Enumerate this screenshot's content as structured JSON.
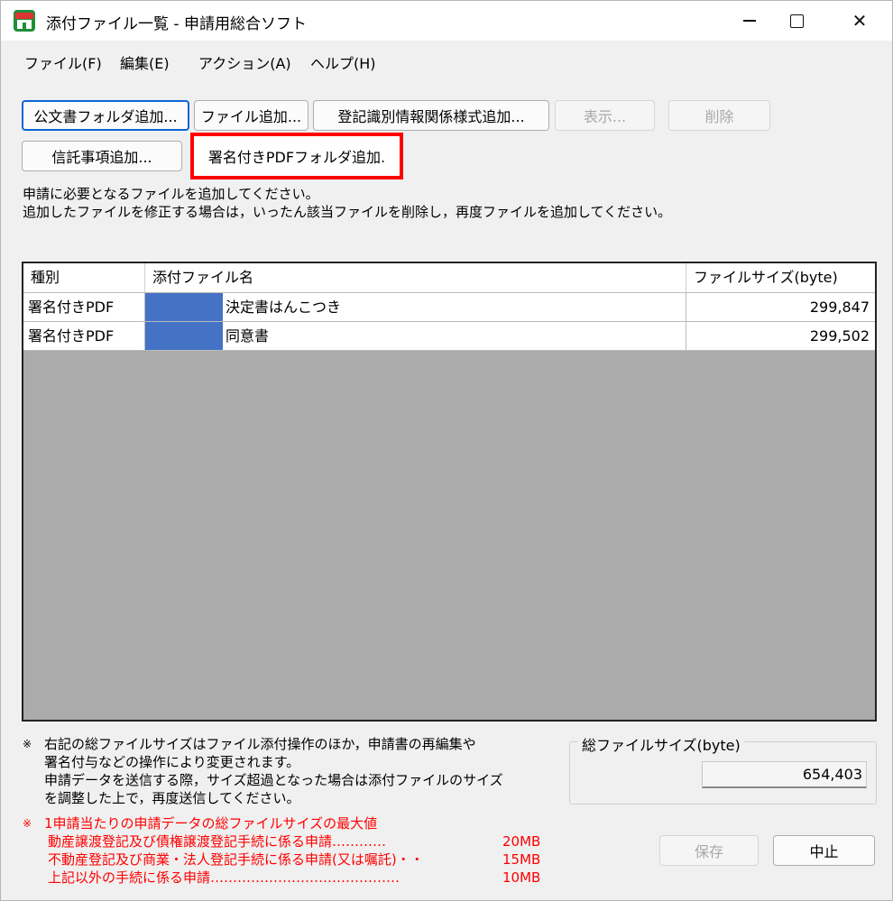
{
  "window": {
    "title": "添付ファイル一覧 - 申請用総合ソフト",
    "app_icon": "app-house-icon",
    "controls": {
      "minimize": "minimize-icon",
      "maximize": "maximize-icon",
      "close": "✕"
    }
  },
  "menu": {
    "items": [
      {
        "label": "ファイル(F)"
      },
      {
        "label": "編集(E)"
      },
      {
        "label": "アクション(A)"
      },
      {
        "label": "ヘルプ(H)"
      }
    ]
  },
  "toolbar": {
    "row1": [
      {
        "label": "公文書フォルダ追加...",
        "state": "focused"
      },
      {
        "label": "ファイル追加...",
        "state": "enabled"
      },
      {
        "label": "登記識別情報関係様式追加...",
        "state": "enabled"
      },
      {
        "label": "表示...",
        "state": "disabled"
      },
      {
        "label": "削除",
        "state": "disabled"
      }
    ],
    "row2": [
      {
        "label": "信託事項追加...",
        "state": "enabled"
      },
      {
        "label": "署名付きPDFフォルダ追加.",
        "state": "highlighted"
      }
    ],
    "highlight_color": "#ff0000"
  },
  "instructions": {
    "line1": "申請に必要となるファイルを追加してください。",
    "line2": "追加したファイルを修正する場合は，いったん該当ファイルを削除し，再度ファイルを追加してください。"
  },
  "table": {
    "columns": [
      "種別",
      "添付ファイル名",
      "ファイルサイズ(byte)"
    ],
    "rows": [
      {
        "type": "署名付きPDF",
        "name": "決定書はんこつき",
        "size": "299,847"
      },
      {
        "type": "署名付きPDF",
        "name": "同意書",
        "size": "299,502"
      }
    ],
    "redaction_color": "#4472c4",
    "empty_area_color": "#ababab"
  },
  "notes": {
    "mark": "※",
    "lines": [
      "右記の総ファイルサイズはファイル添付操作のほか，申請書の再編集や",
      "署名付与などの操作により変更されます。",
      "申請データを送信する際，サイズ超過となった場合は添付ファイルのサイズ",
      "を調整した上で，再度送信してください。"
    ]
  },
  "limits": {
    "mark": "※",
    "heading": "1申請当たりの申請データの総ファイルサイズの最大値",
    "items": [
      {
        "label": "動産譲渡登記及び債権譲渡登記手続に係る申請…………",
        "value": "20MB"
      },
      {
        "label": "不動産登記及び商業・法人登記手続に係る申請(又は嘱託)・・",
        "value": "15MB"
      },
      {
        "label": "上記以外の手続に係る申請……………………………………",
        "value": "10MB"
      }
    ],
    "color": "#ff0000"
  },
  "total": {
    "label": "総ファイルサイズ(byte)",
    "value": "654,403"
  },
  "footer": {
    "save_label": "保存",
    "cancel_label": "中止"
  }
}
